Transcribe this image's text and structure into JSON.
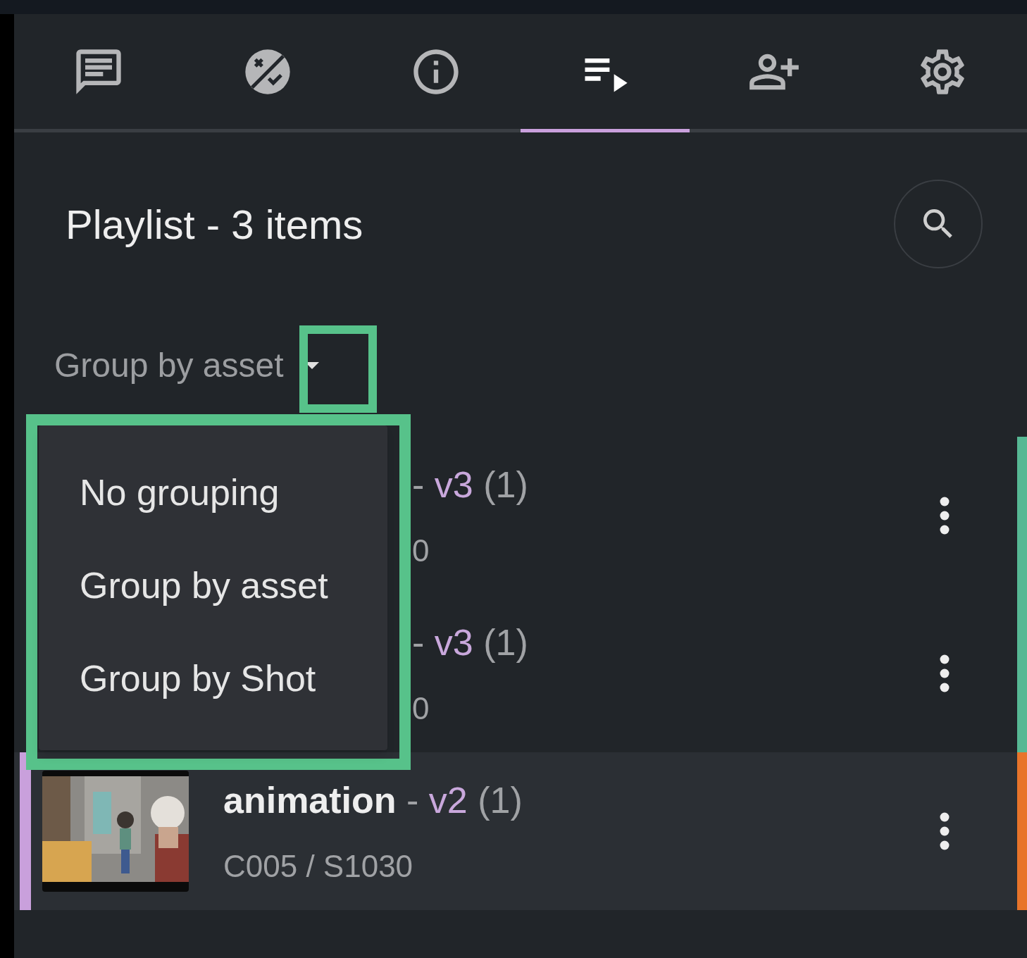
{
  "tabs": [
    {
      "kind": "chat",
      "selected": false
    },
    {
      "kind": "review",
      "selected": false
    },
    {
      "kind": "info",
      "selected": false
    },
    {
      "kind": "playlist",
      "selected": true
    },
    {
      "kind": "people",
      "selected": false
    },
    {
      "kind": "settings",
      "selected": false
    }
  ],
  "header": {
    "title": "Playlist - 3 items"
  },
  "grouping": {
    "label": "Group by asset",
    "expanded": true,
    "options": [
      "No grouping",
      "Group by asset",
      "Group by Shot"
    ]
  },
  "rows": [
    {
      "covered": true,
      "selected": false,
      "separator": "-",
      "version": "v3",
      "count": "(1)",
      "subtitle": "0",
      "color": "#57b894"
    },
    {
      "covered": true,
      "selected": false,
      "separator": "-",
      "version": "v3",
      "count": "(1)",
      "subtitle": "0",
      "color": "#57b894"
    },
    {
      "covered": false,
      "selected": true,
      "name": "animation",
      "separator": "-",
      "version": "v2",
      "count": "(1)",
      "subtitle": "C005 / S1030",
      "color": "#e8742a"
    }
  ]
}
